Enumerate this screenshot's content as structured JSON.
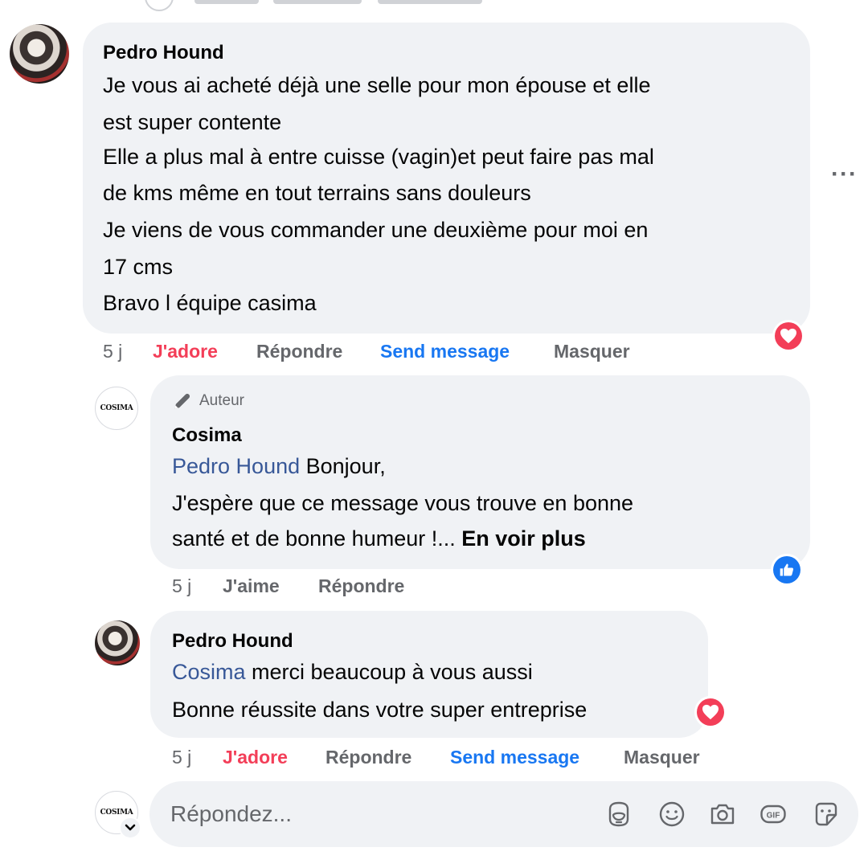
{
  "comment1": {
    "author": "Pedro Hound",
    "lines": [
      "Je vous ai acheté déjà une selle pour mon épouse et elle",
      "est super contente",
      "Elle a plus mal à entre cuisse (vagin)et peut faire pas mal",
      "de kms même en tout terrains sans douleurs",
      "Je viens de vous commander une deuxième pour moi en",
      "17 cms",
      "Bravo l équipe casima"
    ],
    "time": "5 j",
    "reaction_label": "J'adore",
    "reply_label": "Répondre",
    "send_message_label": "Send message",
    "hide_label": "Masquer",
    "reaction_icon": "love-reaction-icon"
  },
  "comment2": {
    "author_badge": "Auteur",
    "author": "Cosima",
    "avatar_text": "COSIMA",
    "mention": "Pedro Hound",
    "line1_rest": " Bonjour,",
    "line2": "J'espère que ce message vous trouve en bonne",
    "line3": "santé et de bonne humeur !... ",
    "see_more": "En voir plus",
    "time": "5 j",
    "like_label": "J'aime",
    "reply_label": "Répondre",
    "reaction_icon": "like-reaction-icon"
  },
  "comment3": {
    "author": "Pedro Hound",
    "mention": "Cosima",
    "line1_rest": " merci beaucoup à vous aussi",
    "line2": "Bonne réussite dans votre super entreprise",
    "time": "5 j",
    "reaction_label": "J'adore",
    "reply_label": "Répondre",
    "send_message_label": "Send message",
    "hide_label": "Masquer",
    "reaction_icon": "love-reaction-icon"
  },
  "reply_box": {
    "avatar_text": "COSIMA",
    "placeholder": "Répondez...",
    "tools": [
      "avatar-sticker-icon",
      "emoji-icon",
      "camera-icon",
      "gif-icon",
      "sticker-icon"
    ]
  },
  "more_options_label": "···",
  "colors": {
    "bubble_bg": "#f0f2f5",
    "secondary_text": "#65676b",
    "love": "#f33e58",
    "link_blue": "#1877f2",
    "mention_blue": "#385898"
  }
}
